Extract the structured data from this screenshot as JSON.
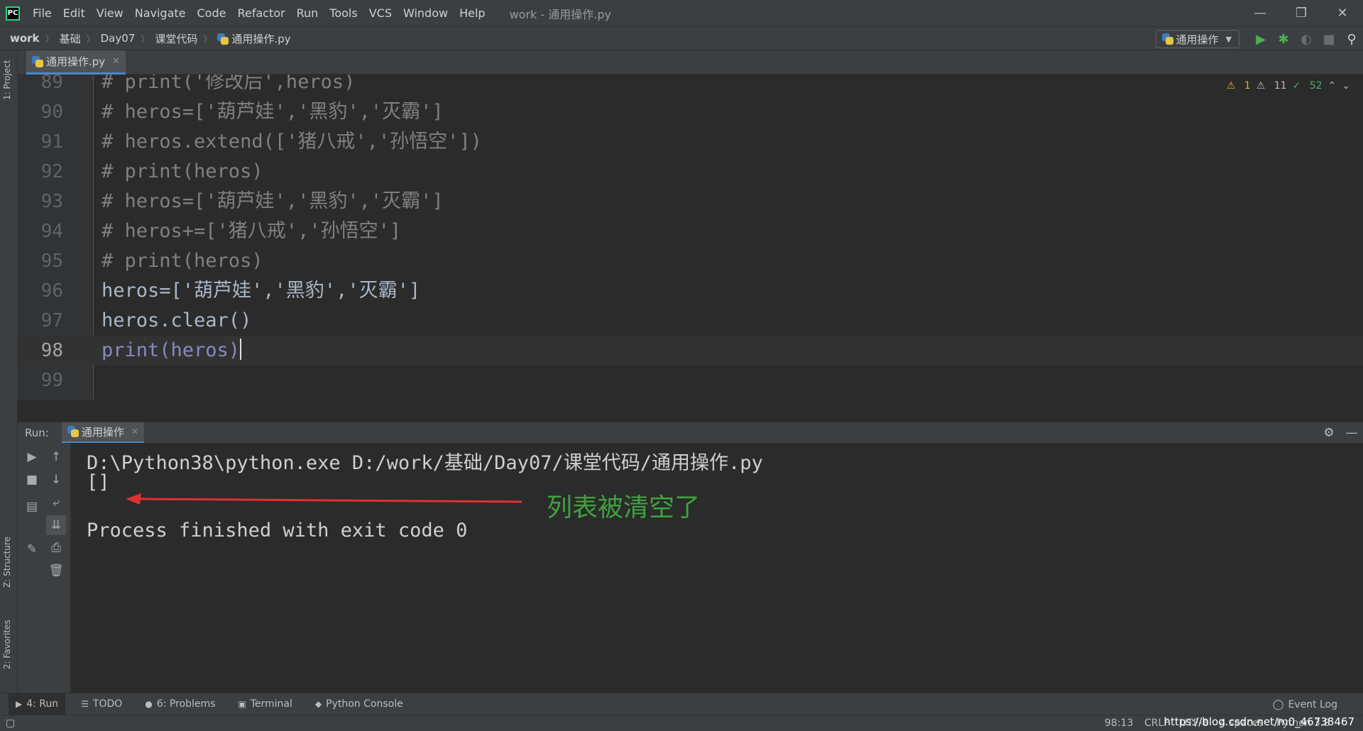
{
  "menu": {
    "logo": "PC",
    "items": [
      "File",
      "Edit",
      "View",
      "Navigate",
      "Code",
      "Refactor",
      "Run",
      "Tools",
      "VCS",
      "Window",
      "Help"
    ],
    "window_title": "work - 通用操作.py",
    "controls": {
      "minimize": "—",
      "restore": "❐",
      "close": "✕"
    }
  },
  "breadcrumb": [
    "work",
    "基础",
    "Day07",
    "课堂代码",
    "通用操作.py"
  ],
  "run_config": {
    "label": "通用操作"
  },
  "side_tabs": {
    "project": "1: Project",
    "structure": "Z: Structure",
    "favorites": "2: Favorites"
  },
  "editor_tab": {
    "label": "通用操作.py"
  },
  "inspections": {
    "errors": "1",
    "warnings": "11",
    "typos": "52"
  },
  "code": {
    "lines": [
      {
        "n": "89",
        "text": "# print('修改后',heros)"
      },
      {
        "n": "90",
        "text": "# heros=['葫芦娃','黑豹','灭霸']"
      },
      {
        "n": "91",
        "text": "# heros.extend(['猪八戒','孙悟空'])"
      },
      {
        "n": "92",
        "text": "# print(heros)"
      },
      {
        "n": "93",
        "text": "# heros=['葫芦娃','黑豹','灭霸']"
      },
      {
        "n": "94",
        "text": "# heros+=['猪八戒','孙悟空']"
      },
      {
        "n": "95",
        "text": "# print(heros)"
      },
      {
        "n": "96",
        "text": "heros=['葫芦娃','黑豹','灭霸']"
      },
      {
        "n": "97",
        "text": "heros.clear()"
      },
      {
        "n": "98",
        "text": "print(heros)"
      },
      {
        "n": "99",
        "text": ""
      }
    ]
  },
  "run_panel": {
    "label": "Run:",
    "tab": "通用操作",
    "console": [
      "D:\\Python38\\python.exe D:/work/基础/Day07/课堂代码/通用操作.py",
      "[]",
      "",
      "Process finished with exit code 0"
    ],
    "annotation": "列表被清空了",
    "annotation_color": "#3ea33e",
    "arrow_color": "#e03030"
  },
  "bottom_tools": [
    {
      "label": "4: Run",
      "icon": "play-icon"
    },
    {
      "label": "TODO",
      "icon": "list-icon"
    },
    {
      "label": "6: Problems",
      "icon": "info-icon"
    },
    {
      "label": "Terminal",
      "icon": "terminal-icon"
    },
    {
      "label": "Python Console",
      "icon": "python-icon"
    }
  ],
  "event_log": "Event Log",
  "status": {
    "position": "98:13",
    "line_sep": "CRLF",
    "encoding": "UTF-8",
    "indent": "4 spaces",
    "interpreter": "Python 3.8",
    "watermark": "https://blog.csdn.net/m0_46738467"
  },
  "colors": {
    "accent": "#4a88c7",
    "string": "#6a8759",
    "comment": "#808080",
    "builtin": "#8888c6"
  }
}
